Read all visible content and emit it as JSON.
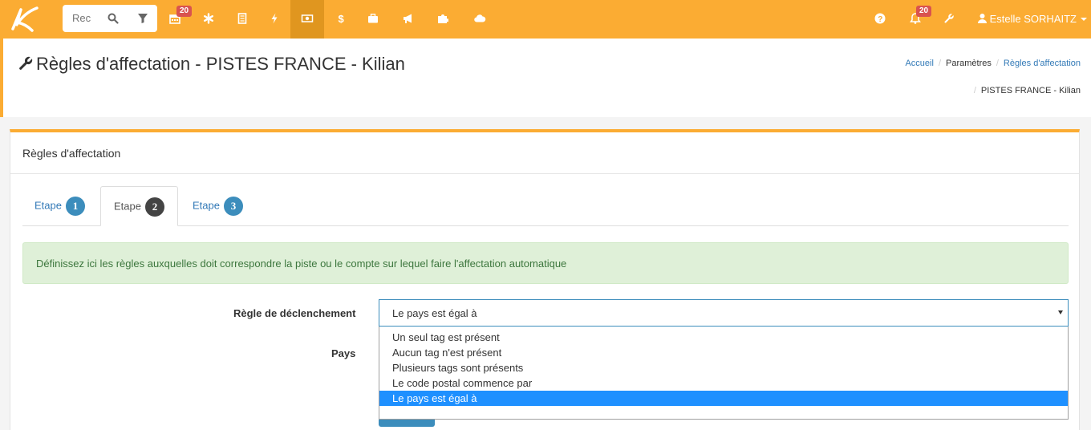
{
  "topbar": {
    "search_placeholder": "Rec",
    "calendar_badge": "20",
    "notifications_badge": "20",
    "user_name": "Estelle SORHAITZ",
    "icons": [
      "logo",
      "search-icon",
      "filter-icon",
      "calendar-icon",
      "asterisk-icon",
      "document-icon",
      "bolt-icon",
      "money-icon",
      "dollar-icon",
      "briefcase-icon",
      "megaphone-icon",
      "puzzle-icon",
      "cloud-icon",
      "question-icon",
      "bell-icon",
      "wrench-icon",
      "user-icon"
    ]
  },
  "header": {
    "title": "Règles d'affectation - PISTES FRANCE - Kilian",
    "breadcrumb": [
      "Accueil",
      "Paramètres",
      "Règles d'affectation",
      "PISTES FRANCE - Kilian"
    ]
  },
  "panel": {
    "title": "Règles d'affectation",
    "tabs": [
      {
        "label": "Etape",
        "num": "1"
      },
      {
        "label": "Etape",
        "num": "2"
      },
      {
        "label": "Etape",
        "num": "3"
      }
    ],
    "alert": "Définissez ici les règles auxquelles doit correspondre la piste ou le compte sur lequel faire l'affectation automatique",
    "form": {
      "trigger_label": "Règle de déclenchement",
      "trigger_value": "Le pays est égal à",
      "country_label": "Pays",
      "options": [
        "Un seul tag est présent",
        "Aucun tag n'est présent",
        "Plusieurs tags sont présents",
        "Le code postal commence par",
        "Le pays est égal à"
      ]
    }
  },
  "colors": {
    "accent": "#fbac33",
    "link": "#337ab7",
    "badge": "#d9534f",
    "highlight": "#1e90ff"
  }
}
